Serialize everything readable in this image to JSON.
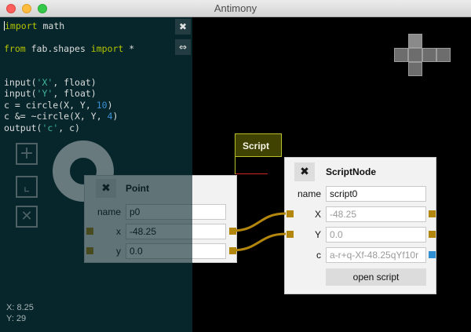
{
  "window": {
    "title": "Antimony"
  },
  "editor": {
    "lines": [
      [
        {
          "t": "import",
          "c": "kw"
        },
        {
          "t": " math"
        }
      ],
      [],
      [
        {
          "t": "from",
          "c": "kw"
        },
        {
          "t": " fab.shapes "
        },
        {
          "t": "import",
          "c": "kw"
        },
        {
          "t": " *"
        }
      ],
      [],
      [],
      [
        {
          "t": "input("
        },
        {
          "t": "'X'",
          "c": "st"
        },
        {
          "t": ", float)"
        }
      ],
      [
        {
          "t": "input("
        },
        {
          "t": "'Y'",
          "c": "st"
        },
        {
          "t": ", float)"
        }
      ],
      [
        {
          "t": "c = circle(X, Y, "
        },
        {
          "t": "10",
          "c": "nu"
        },
        {
          "t": ")"
        }
      ],
      [
        {
          "t": "c &= ~circle(X, Y, "
        },
        {
          "t": "4",
          "c": "nu"
        },
        {
          "t": ")"
        }
      ],
      [
        {
          "t": "output("
        },
        {
          "t": "'c'",
          "c": "st"
        },
        {
          "t": ", c)"
        }
      ]
    ],
    "close_button_icon": "close-x-icon",
    "swap_button_icon": "left-right-arrow-icon",
    "close_glyph": "✖",
    "swap_glyph": "⇔"
  },
  "toolbar": {
    "add_glyph": "+",
    "translate_glyph": "⌞",
    "delete_glyph": "✕"
  },
  "status": {
    "x_readout": "X: 8.25",
    "y_readout": "Y: 29"
  },
  "script_tab": {
    "label": "Script"
  },
  "point_node": {
    "title": "Point",
    "close_glyph": "✖",
    "fields": [
      {
        "label": "name",
        "value": "p0"
      },
      {
        "label": "x",
        "value": "-48.25"
      },
      {
        "label": "y",
        "value": "0.0"
      }
    ]
  },
  "script_node": {
    "title": "ScriptNode",
    "close_glyph": "✖",
    "fields": [
      {
        "label": "name",
        "value": "script0"
      },
      {
        "label": "X",
        "value": "-48.25"
      },
      {
        "label": "Y",
        "value": "0.0"
      },
      {
        "label": "c",
        "value": "a-r+q-Xf-48.25qYf10r"
      }
    ],
    "open_button_label": "open script"
  },
  "colors": {
    "editor_bg": "#06262b",
    "keyword": "#b5c400",
    "string": "#3fb5a0",
    "number": "#3a8fd6",
    "port": "#b3860d",
    "output_port": "#2f8fd2",
    "wire": "#b3860d",
    "script_tab_border": "#b9be2a"
  }
}
